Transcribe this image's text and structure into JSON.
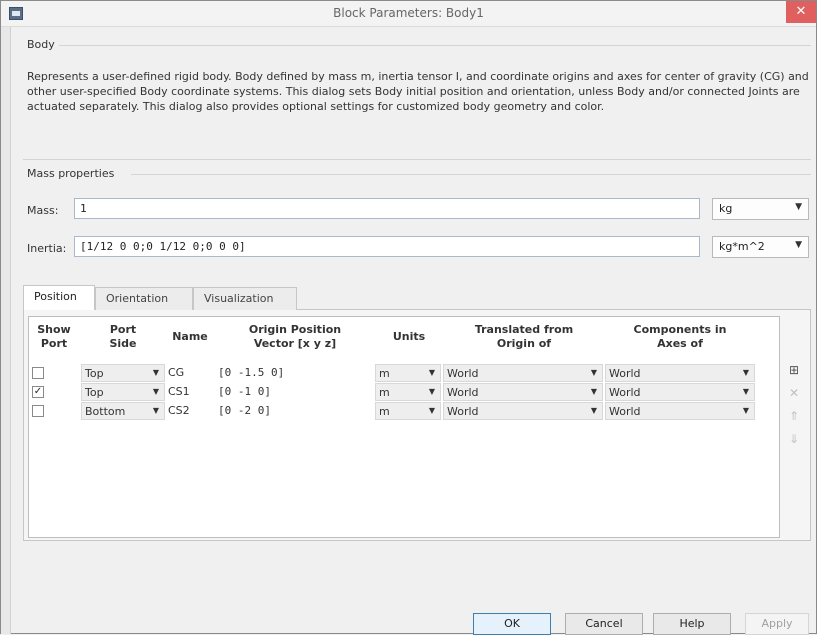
{
  "window": {
    "title": "Block Parameters: Body1",
    "close_glyph": "✕",
    "icon": "app-icon"
  },
  "body_group": {
    "label": "Body",
    "description": "Represents a user-defined rigid body. Body defined by mass m, inertia tensor I, and coordinate origins and axes for center of gravity (CG) and other user-specified Body coordinate systems. This dialog sets Body initial position and orientation, unless Body and/or connected Joints are actuated separately. This dialog also provides optional settings for customized body geometry and color."
  },
  "mass_properties": {
    "label": "Mass properties",
    "mass_label": "Mass:",
    "mass_value": "1",
    "mass_unit": "kg",
    "inertia_label": "Inertia:",
    "inertia_value": "[1/12 0 0;0 1/12 0;0 0 0]",
    "inertia_unit": "kg*m^2"
  },
  "tabs": [
    {
      "label": "Position",
      "active": true
    },
    {
      "label": "Orientation",
      "active": false
    },
    {
      "label": "Visualization",
      "active": false
    }
  ],
  "table": {
    "headers": [
      "Show\nPort",
      "Port\nSide",
      "Name",
      "Origin Position\nVector [x y z]",
      "Units",
      "Translated from\nOrigin of",
      "Components in\nAxes of"
    ],
    "rows": [
      {
        "show_port": false,
        "port_side": "Top",
        "name": "CG",
        "origin": "[0 -1.5 0]",
        "units": "m",
        "translated_from": "World",
        "components_in": "World"
      },
      {
        "show_port": true,
        "port_side": "Top",
        "name": "CS1",
        "origin": "[0 -1 0]",
        "units": "m",
        "translated_from": "World",
        "components_in": "World"
      },
      {
        "show_port": false,
        "port_side": "Bottom",
        "name": "CS2",
        "origin": "[0 -2 0]",
        "units": "m",
        "translated_from": "World",
        "components_in": "World"
      }
    ]
  },
  "side_buttons": [
    {
      "icon": "add-row-icon",
      "glyph": "⊞",
      "enabled": true
    },
    {
      "icon": "delete-row-icon",
      "glyph": "✕",
      "enabled": false
    },
    {
      "icon": "move-up-icon",
      "glyph": "⇑",
      "enabled": false
    },
    {
      "icon": "move-down-icon",
      "glyph": "⇓",
      "enabled": false
    }
  ],
  "buttons": {
    "ok": "OK",
    "cancel": "Cancel",
    "help": "Help",
    "apply": "Apply"
  },
  "colors": {
    "close": "#e06060",
    "default_button_border": "#3c7fb1"
  }
}
